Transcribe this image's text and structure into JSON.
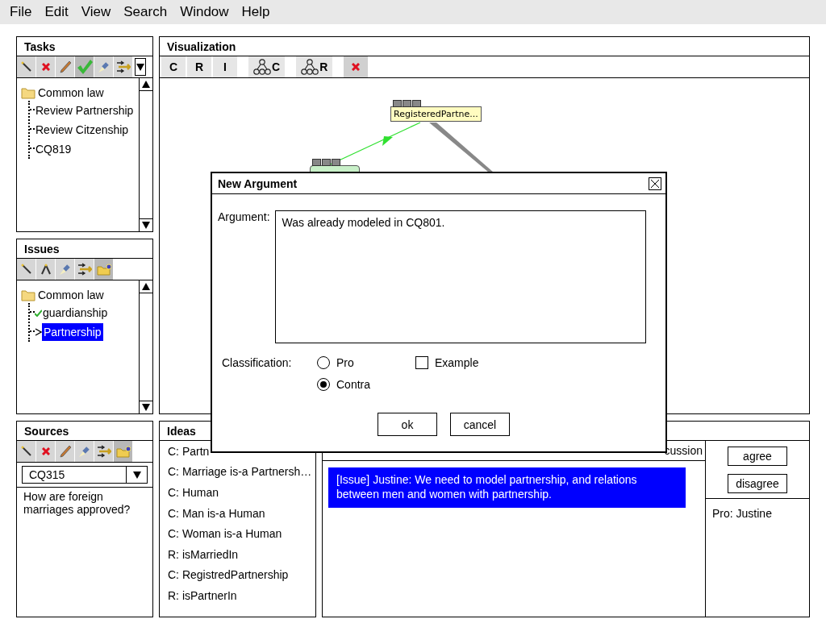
{
  "menu": [
    "File",
    "Edit",
    "View",
    "Search",
    "Window",
    "Help"
  ],
  "tasks": {
    "title": "Tasks",
    "tree": [
      {
        "label": "Common law",
        "children": [
          {
            "label": "Review Partnership"
          },
          {
            "label": "Review Citzenship"
          },
          {
            "label": "CQ819"
          }
        ]
      }
    ]
  },
  "issues": {
    "title": "Issues",
    "tree": [
      {
        "label": "Common law",
        "children": [
          {
            "label": "guardianship",
            "checked": true,
            "selected": false
          },
          {
            "label": "Partnership",
            "checked": false,
            "selected": true
          }
        ]
      }
    ]
  },
  "visualization": {
    "title": "Visualization",
    "toolbar": [
      {
        "label": "C",
        "kind": "text"
      },
      {
        "label": "R",
        "kind": "text"
      },
      {
        "label": "I",
        "kind": "text"
      },
      {
        "label": "C",
        "kind": "tree"
      },
      {
        "label": "R",
        "kind": "tree"
      },
      {
        "kind": "delete"
      }
    ],
    "node": "RegisteredPartne..."
  },
  "sources": {
    "title": "Sources",
    "selected": "CQ315",
    "text": "How are foreign marriages approved?"
  },
  "ideas": {
    "title": "Ideas",
    "items": [
      "C: Partn",
      "C: Marriage is-a Partnersh…",
      "C: Human",
      "C: Man is-a Human",
      "C: Woman is-a Human",
      "R: isMarriedIn",
      "C: RegistredPartnership",
      "R: isPartnerIn"
    ]
  },
  "discussion": {
    "status": "cussion",
    "message": "[Issue] Justine: We need to model partnership, and relations between men and women with partnership.",
    "buttons": [
      "agree",
      "disagree"
    ],
    "votes": "Pro: Justine"
  },
  "dialog": {
    "title": "New Argument",
    "argument_label": "Argument:",
    "argument": "Was already modeled in CQ801.",
    "classification_label": "Classification:",
    "options": [
      {
        "label": "Pro",
        "kind": "radio",
        "selected": false
      },
      {
        "label": "Example",
        "kind": "checkbox",
        "checked": false
      },
      {
        "label": "Contra",
        "kind": "radio",
        "selected": true
      }
    ],
    "buttons": [
      "ok",
      "cancel"
    ]
  }
}
